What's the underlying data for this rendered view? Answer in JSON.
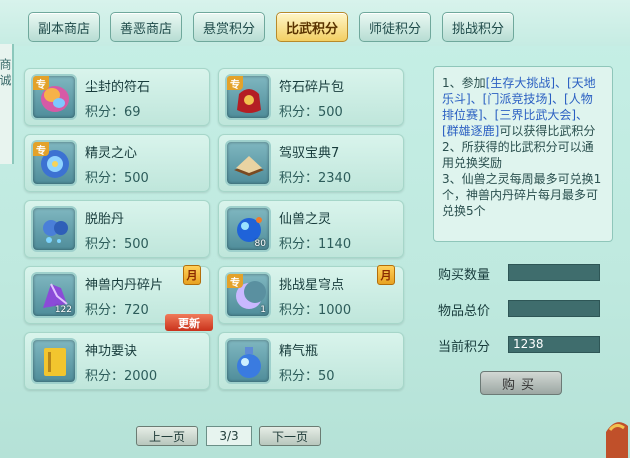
{
  "tabs": [
    "副本商店",
    "善恶商店",
    "悬赏积分",
    "比武积分",
    "师徒积分",
    "挑战积分"
  ],
  "active_tab": 3,
  "left_edge_text": "商 诚",
  "price_label": "积分：",
  "items": [
    {
      "name": "尘封的符石",
      "price": "69",
      "icon": "runestone-icon",
      "special": "专",
      "qty": ""
    },
    {
      "name": "符石碎片包",
      "price": "500",
      "icon": "red-pouch-icon",
      "special": "专",
      "qty": ""
    },
    {
      "name": "精灵之心",
      "price": "500",
      "icon": "spirit-heart-icon",
      "special": "专",
      "qty": ""
    },
    {
      "name": "驾驭宝典7",
      "price": "2340",
      "icon": "book-icon",
      "special": "",
      "qty": ""
    },
    {
      "name": "脱胎丹",
      "price": "500",
      "icon": "pill-icon",
      "special": "",
      "qty": ""
    },
    {
      "name": "仙兽之灵",
      "price": "1140",
      "icon": "blue-orb-icon",
      "special": "",
      "qty": "80"
    },
    {
      "name": "神兽内丹碎片",
      "price": "720",
      "icon": "purple-crystal-icon",
      "special": "",
      "qty": "122",
      "month": "月",
      "update": "更新"
    },
    {
      "name": "挑战星穹点",
      "price": "1000",
      "icon": "crescent-moon-icon",
      "special": "专",
      "qty": "1",
      "month": "月"
    },
    {
      "name": "神功要诀",
      "price": "2000",
      "icon": "scroll-book-icon",
      "special": "",
      "qty": ""
    },
    {
      "name": "精气瓶",
      "price": "50",
      "icon": "potion-bottle-icon",
      "special": "",
      "qty": ""
    }
  ],
  "info": {
    "l1a": "1、参加",
    "l1b": "[生存大挑战]、[天地乐斗]、[门派竞技场]、[人物排位赛]、[三界比武大会]、[群雄逐鹿]",
    "l1c": "可以获得比武积分",
    "l2": "2、所获得的比武积分可以通用兑换奖励",
    "l3": "3、仙兽之灵每周最多可兑换1个，神兽内丹碎片每月最多可兑换5个"
  },
  "form": {
    "qty_label": "购买数量",
    "total_label": "物品总价",
    "points_label": "当前积分",
    "qty_value": "",
    "total_value": "",
    "points_value": "1238",
    "buy": "购买"
  },
  "pager": {
    "prev": "上一页",
    "next": "下一页",
    "indicator": "3/3"
  }
}
